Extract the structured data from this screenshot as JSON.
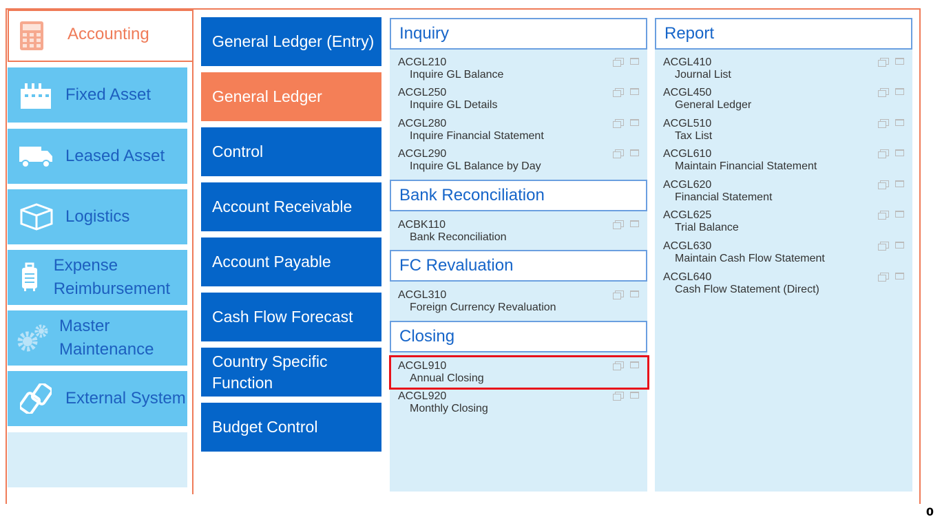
{
  "nav": {
    "active": {
      "label": "Accounting",
      "icon": "calculator-icon"
    },
    "items": [
      {
        "label": "Fixed Asset",
        "icon": "factory-icon"
      },
      {
        "label": "Leased Asset",
        "icon": "truck-icon"
      },
      {
        "label": "Logistics",
        "icon": "box-icon"
      },
      {
        "label": "Expense Reimbursement",
        "icon": "luggage-icon"
      },
      {
        "label": "Master Maintenance",
        "icon": "gears-icon"
      },
      {
        "label": "External System",
        "icon": "link-icon"
      }
    ]
  },
  "categories": [
    {
      "label": "General Ledger (Entry)",
      "active": false
    },
    {
      "label": "General Ledger",
      "active": true
    },
    {
      "label": "Control",
      "active": false
    },
    {
      "label": "Account Receivable",
      "active": false
    },
    {
      "label": "Account Payable",
      "active": false
    },
    {
      "label": "Cash Flow Forecast",
      "active": false
    },
    {
      "label": "Country Specific Function",
      "active": false
    },
    {
      "label": "Budget Control",
      "active": false
    }
  ],
  "sections": {
    "inquiry": {
      "title": "Inquiry",
      "entries": [
        {
          "code": "ACGL210",
          "name": "Inquire GL Balance"
        },
        {
          "code": "ACGL250",
          "name": "Inquire GL Details"
        },
        {
          "code": "ACGL280",
          "name": "Inquire Financial Statement"
        },
        {
          "code": "ACGL290",
          "name": "Inquire GL Balance by Day"
        }
      ]
    },
    "bank": {
      "title": "Bank Reconciliation",
      "entries": [
        {
          "code": "ACBK110",
          "name": "Bank Reconciliation"
        }
      ]
    },
    "fc": {
      "title": "FC Revaluation",
      "entries": [
        {
          "code": "ACGL310",
          "name": "Foreign Currency Revaluation"
        }
      ]
    },
    "closing": {
      "title": "Closing",
      "entries": [
        {
          "code": "ACGL910",
          "name": "Annual Closing"
        },
        {
          "code": "ACGL920",
          "name": "Monthly Closing"
        }
      ]
    },
    "report": {
      "title": "Report",
      "entries": [
        {
          "code": "ACGL410",
          "name": "Journal List"
        },
        {
          "code": "ACGL450",
          "name": "General Ledger"
        },
        {
          "code": "ACGL510",
          "name": "Tax List"
        },
        {
          "code": "ACGL610",
          "name": "Maintain Financial Statement"
        },
        {
          "code": "ACGL620",
          "name": "Financial Statement"
        },
        {
          "code": "ACGL625",
          "name": "Trial Balance"
        },
        {
          "code": "ACGL630",
          "name": "Maintain Cash Flow Statement"
        },
        {
          "code": "ACGL640",
          "name": "Cash Flow Statement (Direct)"
        }
      ]
    }
  },
  "corner_label": "0",
  "colors": {
    "accent": "#ef7b58",
    "nav": "#65c5f1",
    "category": "#0565c9",
    "panel": "#d8eef9",
    "highlight": "#e8111a"
  }
}
